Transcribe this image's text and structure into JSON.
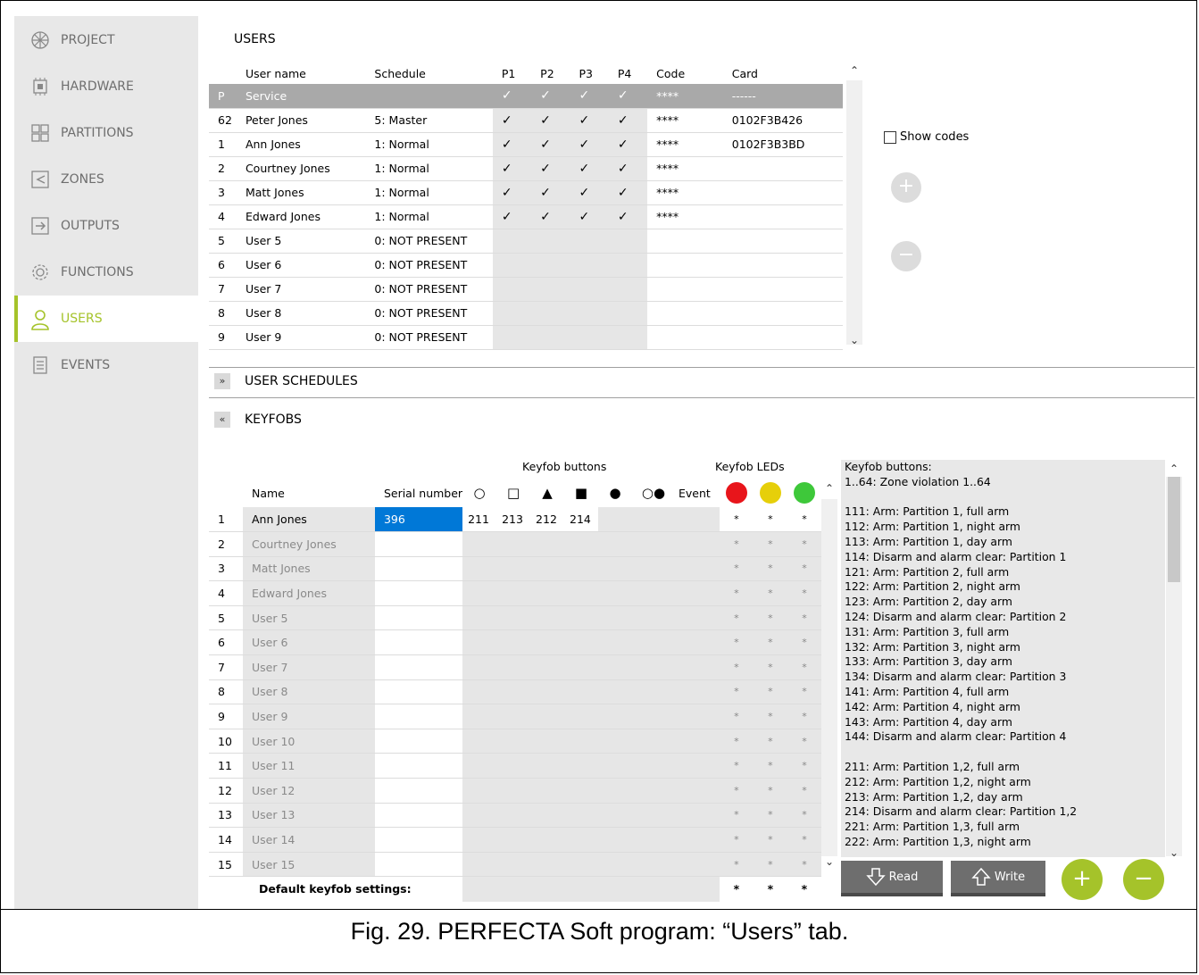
{
  "sidebar": {
    "items": [
      {
        "label": "PROJECT",
        "icon": "project-icon"
      },
      {
        "label": "HARDWARE",
        "icon": "hardware-icon"
      },
      {
        "label": "PARTITIONS",
        "icon": "partitions-icon"
      },
      {
        "label": "ZONES",
        "icon": "zones-icon"
      },
      {
        "label": "OUTPUTS",
        "icon": "outputs-icon"
      },
      {
        "label": "FUNCTIONS",
        "icon": "gear-icon"
      },
      {
        "label": "USERS",
        "icon": "user-icon",
        "active": true
      },
      {
        "label": "EVENTS",
        "icon": "events-icon"
      }
    ],
    "accent_color": "#a5c32a"
  },
  "users": {
    "title": "USERS",
    "headers": [
      "",
      "User name",
      "Schedule",
      "P1",
      "P2",
      "P3",
      "P4",
      "Code",
      "Card"
    ],
    "check_mark": "✓",
    "rows": [
      {
        "no": "P",
        "name": "Service",
        "schedule": "",
        "p": [
          true,
          true,
          true,
          true
        ],
        "code": "****",
        "card": "------",
        "style": "service"
      },
      {
        "no": "62",
        "name": "Peter Jones",
        "schedule": "5: Master",
        "p": [
          true,
          true,
          true,
          true
        ],
        "code": "****",
        "card": "0102F3B426",
        "style": "bold"
      },
      {
        "no": "1",
        "name": "Ann Jones",
        "schedule": "1: Normal",
        "p": [
          true,
          true,
          true,
          true
        ],
        "code": "****",
        "card": "0102F3B3BD"
      },
      {
        "no": "2",
        "name": "Courtney Jones",
        "schedule": "1: Normal",
        "p": [
          true,
          true,
          true,
          true
        ],
        "code": "****",
        "card": ""
      },
      {
        "no": "3",
        "name": "Matt Jones",
        "schedule": "1: Normal",
        "p": [
          true,
          true,
          true,
          true
        ],
        "code": "****",
        "card": ""
      },
      {
        "no": "4",
        "name": "Edward Jones",
        "schedule": "1: Normal",
        "p": [
          true,
          true,
          true,
          true
        ],
        "code": "****",
        "card": ""
      },
      {
        "no": "5",
        "name": "User 5",
        "schedule": "0: NOT PRESENT",
        "p": [
          false,
          false,
          false,
          false
        ],
        "code": "",
        "card": ""
      },
      {
        "no": "6",
        "name": "User 6",
        "schedule": "0: NOT PRESENT",
        "p": [
          false,
          false,
          false,
          false
        ],
        "code": "",
        "card": ""
      },
      {
        "no": "7",
        "name": "User 7",
        "schedule": "0: NOT PRESENT",
        "p": [
          false,
          false,
          false,
          false
        ],
        "code": "",
        "card": ""
      },
      {
        "no": "8",
        "name": "User 8",
        "schedule": "0: NOT PRESENT",
        "p": [
          false,
          false,
          false,
          false
        ],
        "code": "",
        "card": ""
      },
      {
        "no": "9",
        "name": "User 9",
        "schedule": "0: NOT PRESENT",
        "p": [
          false,
          false,
          false,
          false
        ],
        "code": "",
        "card": ""
      }
    ],
    "show_codes_label": "Show codes",
    "add_symbol": "+",
    "remove_symbol": "−"
  },
  "user_schedules": {
    "title": "USER SCHEDULES",
    "toggle": "»"
  },
  "keyfobs": {
    "title": "KEYFOBS",
    "toggle": "«",
    "group_buttons": "Keyfob buttons",
    "group_leds": "Keyfob LEDs",
    "headers": {
      "name": "Name",
      "serial": "Serial number",
      "event": "Event"
    },
    "button_symbols": [
      "○",
      "□",
      "▲",
      "■",
      "●",
      "○●"
    ],
    "led_colors": [
      "#e8151b",
      "#e6cf0a",
      "#3ec83a"
    ],
    "rows": [
      {
        "no": "1",
        "name": "Ann Jones",
        "serial": "396",
        "buttons": [
          "211",
          "213",
          "212",
          "214",
          "",
          ""
        ],
        "leds": [
          "*",
          "*",
          "*"
        ],
        "active": true
      },
      {
        "no": "2",
        "name": "Courtney Jones",
        "serial": "",
        "buttons": [
          "",
          "",
          "",
          "",
          "",
          ""
        ],
        "leds": [
          "*",
          "*",
          "*"
        ]
      },
      {
        "no": "3",
        "name": "Matt Jones",
        "serial": "",
        "buttons": [
          "",
          "",
          "",
          "",
          "",
          ""
        ],
        "leds": [
          "*",
          "*",
          "*"
        ]
      },
      {
        "no": "4",
        "name": "Edward Jones",
        "serial": "",
        "buttons": [
          "",
          "",
          "",
          "",
          "",
          ""
        ],
        "leds": [
          "*",
          "*",
          "*"
        ]
      },
      {
        "no": "5",
        "name": "User 5",
        "serial": "",
        "buttons": [
          "",
          "",
          "",
          "",
          "",
          ""
        ],
        "leds": [
          "*",
          "*",
          "*"
        ]
      },
      {
        "no": "6",
        "name": "User 6",
        "serial": "",
        "buttons": [
          "",
          "",
          "",
          "",
          "",
          ""
        ],
        "leds": [
          "*",
          "*",
          "*"
        ]
      },
      {
        "no": "7",
        "name": "User 7",
        "serial": "",
        "buttons": [
          "",
          "",
          "",
          "",
          "",
          ""
        ],
        "leds": [
          "*",
          "*",
          "*"
        ]
      },
      {
        "no": "8",
        "name": "User 8",
        "serial": "",
        "buttons": [
          "",
          "",
          "",
          "",
          "",
          ""
        ],
        "leds": [
          "*",
          "*",
          "*"
        ]
      },
      {
        "no": "9",
        "name": "User 9",
        "serial": "",
        "buttons": [
          "",
          "",
          "",
          "",
          "",
          ""
        ],
        "leds": [
          "*",
          "*",
          "*"
        ]
      },
      {
        "no": "10",
        "name": "User 10",
        "serial": "",
        "buttons": [
          "",
          "",
          "",
          "",
          "",
          ""
        ],
        "leds": [
          "*",
          "*",
          "*"
        ]
      },
      {
        "no": "11",
        "name": "User 11",
        "serial": "",
        "buttons": [
          "",
          "",
          "",
          "",
          "",
          ""
        ],
        "leds": [
          "*",
          "*",
          "*"
        ]
      },
      {
        "no": "12",
        "name": "User 12",
        "serial": "",
        "buttons": [
          "",
          "",
          "",
          "",
          "",
          ""
        ],
        "leds": [
          "*",
          "*",
          "*"
        ]
      },
      {
        "no": "13",
        "name": "User 13",
        "serial": "",
        "buttons": [
          "",
          "",
          "",
          "",
          "",
          ""
        ],
        "leds": [
          "*",
          "*",
          "*"
        ]
      },
      {
        "no": "14",
        "name": "User 14",
        "serial": "",
        "buttons": [
          "",
          "",
          "",
          "",
          "",
          ""
        ],
        "leds": [
          "*",
          "*",
          "*"
        ]
      },
      {
        "no": "15",
        "name": "User 15",
        "serial": "",
        "buttons": [
          "",
          "",
          "",
          "",
          "",
          ""
        ],
        "leds": [
          "*",
          "*",
          "*"
        ]
      }
    ],
    "default_label": "Default keyfob settings:",
    "default_leds": [
      "*",
      "*",
      "*"
    ],
    "selected_cell_color": "#0078d7",
    "info_lines": [
      "Keyfob buttons:",
      "  1..64: Zone violation  1..64",
      "",
      "111: Arm: Partition 1, full arm",
      "112: Arm: Partition 1, night arm",
      "113: Arm: Partition 1, day arm",
      "114: Disarm and alarm clear: Partition 1",
      "121: Arm: Partition 2, full arm",
      "122: Arm: Partition 2, night arm",
      "123: Arm: Partition 2, day arm",
      "124: Disarm and alarm clear: Partition 2",
      "131: Arm: Partition 3, full arm",
      "132: Arm: Partition 3, night arm",
      "133: Arm: Partition 3, day arm",
      "134: Disarm and alarm clear: Partition 3",
      "141: Arm: Partition 4, full arm",
      "142: Arm: Partition 4, night arm",
      "143: Arm: Partition 4, day arm",
      "144: Disarm and alarm clear: Partition 4",
      "",
      "211: Arm: Partition 1,2, full arm",
      "212: Arm: Partition 1,2, night arm",
      "213: Arm: Partition 1,2, day arm",
      "214: Disarm and alarm clear: Partition 1,2",
      "221: Arm: Partition 1,3, full arm",
      "222: Arm: Partition 1,3, night arm"
    ],
    "read_label": "Read",
    "write_label": "Write",
    "add_symbol": "+",
    "remove_symbol": "−"
  },
  "caption": "Fig. 29. PERFECTA Soft program: “Users” tab."
}
